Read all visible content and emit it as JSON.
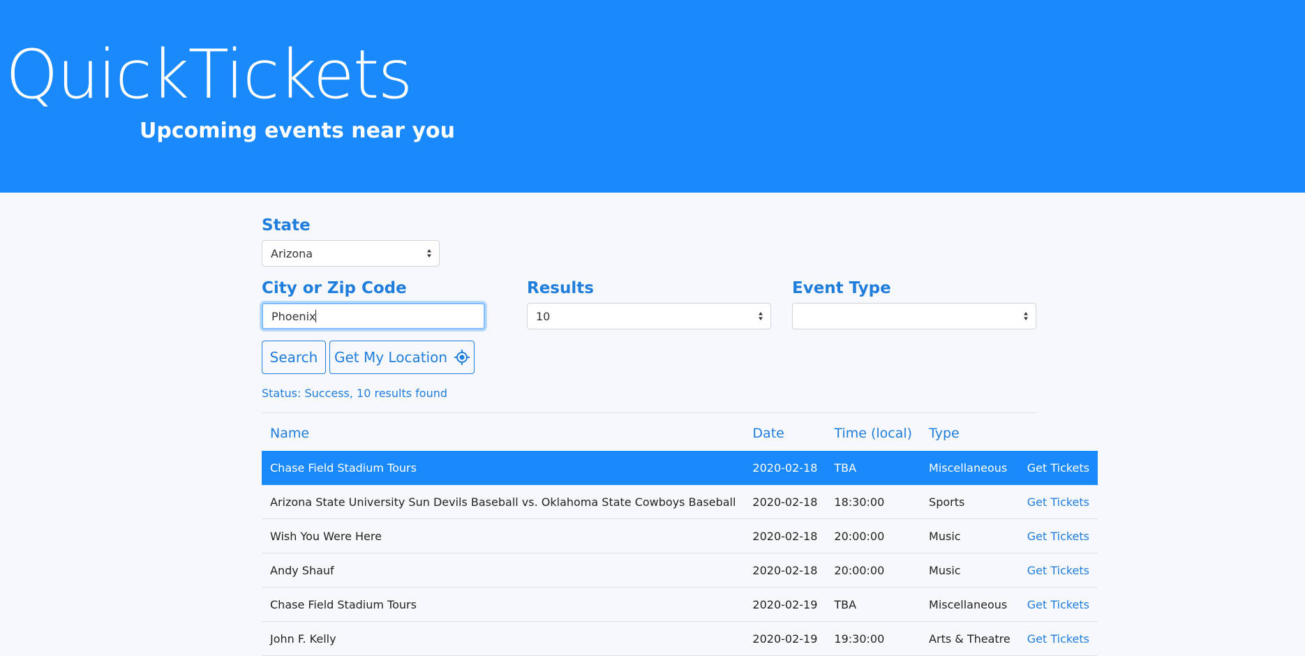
{
  "header": {
    "title": "QuickTickets",
    "subtitle": "Upcoming events near you"
  },
  "form": {
    "state_label": "State",
    "state_value": "Arizona",
    "city_label": "City or Zip Code",
    "city_value": "Phoenix",
    "results_label": "Results",
    "results_value": "10",
    "event_type_label": "Event Type",
    "event_type_value": "",
    "search_label": "Search",
    "location_label": "Get My Location"
  },
  "status": "Status: Success, 10 results found",
  "table": {
    "headers": [
      "Name",
      "Date",
      "Time (local)",
      "Type",
      ""
    ],
    "rows": [
      {
        "name": "Chase Field Stadium Tours",
        "date": "2020-02-18",
        "time": "TBA",
        "type": "Miscellaneous",
        "link": "Get Tickets"
      },
      {
        "name": "Arizona State University Sun Devils Baseball vs. Oklahoma State Cowboys Baseball",
        "date": "2020-02-18",
        "time": "18:30:00",
        "type": "Sports",
        "link": "Get Tickets"
      },
      {
        "name": "Wish You Were Here",
        "date": "2020-02-18",
        "time": "20:00:00",
        "type": "Music",
        "link": "Get Tickets"
      },
      {
        "name": "Andy Shauf",
        "date": "2020-02-18",
        "time": "20:00:00",
        "type": "Music",
        "link": "Get Tickets"
      },
      {
        "name": "Chase Field Stadium Tours",
        "date": "2020-02-19",
        "time": "TBA",
        "type": "Miscellaneous",
        "link": "Get Tickets"
      },
      {
        "name": "John F. Kelly",
        "date": "2020-02-19",
        "time": "19:30:00",
        "type": "Arts & Theatre",
        "link": "Get Tickets"
      }
    ]
  },
  "colors": {
    "brand": "#1989fb",
    "accent": "#1f7ddc",
    "background": "#f7f8fb"
  },
  "icons": {
    "location": "crosshair-icon",
    "select": "sort-caret-icon"
  }
}
